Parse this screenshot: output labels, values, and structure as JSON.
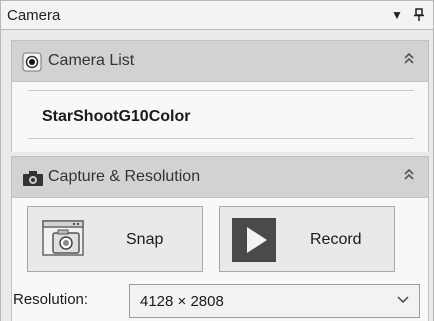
{
  "panel": {
    "title": "Camera",
    "dropdown_icon": "triangle-down-icon",
    "pin_icon": "pin-icon"
  },
  "camera_list": {
    "header": "Camera List",
    "icon": "radio-camera-icon",
    "collapse_icon": "double-chevron-up-icon",
    "items": [
      "StarShootG10Color"
    ]
  },
  "capture": {
    "header": "Capture & Resolution",
    "icon": "camera-icon",
    "collapse_icon": "double-chevron-up-icon",
    "snap_label": "Snap",
    "snap_icon": "snapshot-window-icon",
    "record_label": "Record",
    "record_icon": "play-icon",
    "resolution_label": "Resolution:",
    "resolution_value": "4128 × 2808"
  }
}
